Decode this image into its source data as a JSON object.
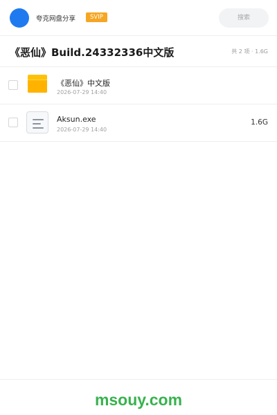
{
  "header": {
    "username": "夸克网盘分享",
    "badge": "SVIP",
    "search_placeholder": "搜索"
  },
  "share": {
    "title": "《恶仙》Build.24332336中文版",
    "summary": "共 2 项 · 1.6G"
  },
  "files": [
    {
      "icon": "folder-icon",
      "name": "《恶仙》中文版",
      "date": "2026-07-29 14:40",
      "size": ""
    },
    {
      "icon": "file-icon",
      "name": "Aksun.exe",
      "date": "2026-07-29 14:40",
      "size": "1.6G"
    }
  ],
  "footer": {
    "watermark": "msouy.com"
  },
  "colors": {
    "avatar": "#1f7af0",
    "badge": "#f5a623",
    "folder": "#ffc107",
    "watermark": "#37b24d"
  }
}
